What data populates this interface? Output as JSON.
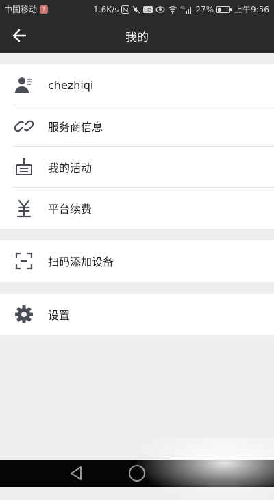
{
  "status_bar": {
    "carrier": "中国移动",
    "carrier_badge": "?",
    "speed": "1.6K/s",
    "hd_label": "HD",
    "network_label": "4G",
    "battery_percent": "27%",
    "battery_level": 0.27,
    "time": "上午9:56"
  },
  "header": {
    "title": "我的",
    "back_icon": "arrow-left-icon"
  },
  "groups": [
    {
      "items": [
        {
          "label": "chezhiqi",
          "icon": "user-card-icon"
        },
        {
          "label": "服务商信息",
          "icon": "link-icon"
        },
        {
          "label": "我的活动",
          "icon": "event-board-icon"
        },
        {
          "label": "平台续费",
          "icon": "yen-icon"
        }
      ]
    },
    {
      "items": [
        {
          "label": "扫码添加设备",
          "icon": "scan-icon"
        }
      ]
    },
    {
      "items": [
        {
          "label": "设置",
          "icon": "gear-icon"
        }
      ]
    }
  ],
  "colors": {
    "bar_background": "#2b2b2d",
    "page_background": "#efefef",
    "icon_color": "#4a4d57"
  }
}
